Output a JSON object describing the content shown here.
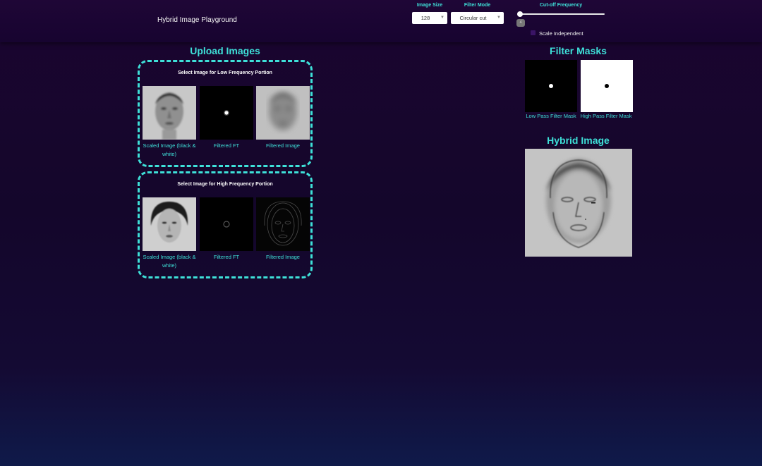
{
  "header": {
    "title": "Hybrid Image Playground",
    "image_size": {
      "label": "Image Size",
      "value": "128"
    },
    "filter_mode": {
      "label": "Filter Mode",
      "value": "Circular cut"
    },
    "cutoff": {
      "label": "Cut-off Frequency",
      "value": "4",
      "fraction": 0.0
    },
    "scale_independent": {
      "label": "Scale Independent",
      "checked": false
    }
  },
  "upload": {
    "title": "Upload Images",
    "low": {
      "title": "Select Image for Low Frequency Portion",
      "captions": [
        "Scaled Image (black & white)",
        "Filtered FT",
        "Filtered Image"
      ]
    },
    "high": {
      "title": "Select Image for High Frequency Portion",
      "captions": [
        "Scaled Image (black & white)",
        "Filtered FT",
        "Filtered Image"
      ]
    }
  },
  "masks": {
    "title": "Filter Masks",
    "low_label": "Low Pass Filter Mask",
    "high_label": "High Pass Filter Mask"
  },
  "hybrid": {
    "title": "Hybrid Image"
  },
  "colors": {
    "accent": "#3ee0d8",
    "background": "#14062b"
  }
}
